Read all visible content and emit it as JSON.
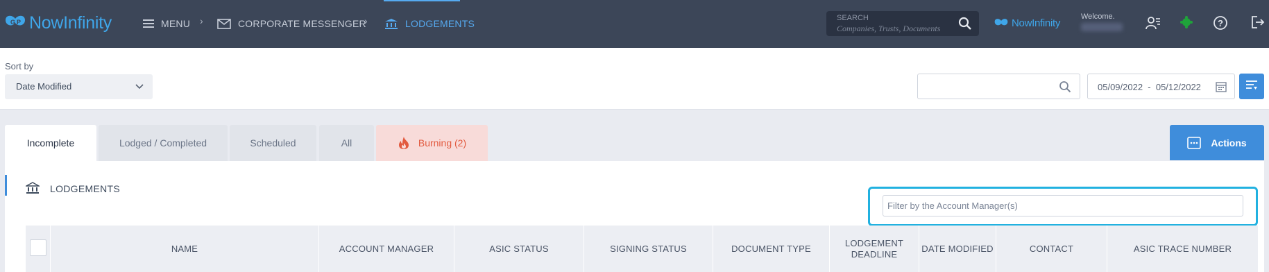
{
  "header": {
    "brand": "NowInfinity",
    "menu_label": "MENU",
    "breadcrumbs": [
      "CORPORATE MESSENGER",
      "LODGEMENTS"
    ],
    "search": {
      "label": "SEARCH",
      "placeholder": "Companies, Trusts, Documents"
    },
    "brand_small": "NowInfinity",
    "welcome": "Welcome."
  },
  "filters": {
    "sort_label": "Sort by",
    "sort_value": "Date Modified",
    "search_value": "",
    "date_range": "05/09/2022  -  05/12/2022"
  },
  "tabs": [
    {
      "label": "Incomplete",
      "active": true
    },
    {
      "label": "Lodged / Completed",
      "active": false
    },
    {
      "label": "Scheduled",
      "active": false
    },
    {
      "label": "All",
      "active": false
    },
    {
      "label": "Burning (2)",
      "active": false
    }
  ],
  "actions_label": "Actions",
  "panel": {
    "title": "LODGEMENTS",
    "account_manager_placeholder": "Filter by the Account Manager(s)"
  },
  "table": {
    "columns": [
      "NAME",
      "ACCOUNT MANAGER",
      "ASIC STATUS",
      "SIGNING STATUS",
      "DOCUMENT TYPE",
      "LODGEMENT DEADLINE",
      "DATE MODIFIED",
      "CONTACT",
      "ASIC TRACE NUMBER"
    ]
  },
  "colors": {
    "topbar": "#3c4658",
    "accent": "#3f8ddb",
    "brand": "#3fa6e9",
    "burning": "#e25a3f",
    "highlight": "#21b1e0"
  }
}
